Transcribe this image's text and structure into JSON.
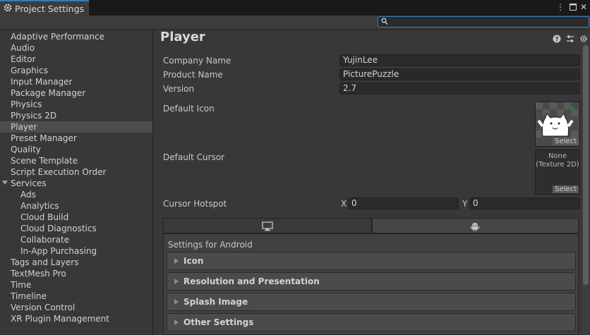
{
  "window": {
    "tab_title": "Project Settings"
  },
  "search": {
    "value": "",
    "placeholder": ""
  },
  "sidebar": {
    "items": [
      {
        "label": "Adaptive Performance"
      },
      {
        "label": "Audio"
      },
      {
        "label": "Editor"
      },
      {
        "label": "Graphics"
      },
      {
        "label": "Input Manager"
      },
      {
        "label": "Package Manager"
      },
      {
        "label": "Physics"
      },
      {
        "label": "Physics 2D"
      },
      {
        "label": "Player"
      },
      {
        "label": "Preset Manager"
      },
      {
        "label": "Quality"
      },
      {
        "label": "Scene Template"
      },
      {
        "label": "Script Execution Order"
      },
      {
        "label": "Services"
      },
      {
        "label": "Ads"
      },
      {
        "label": "Analytics"
      },
      {
        "label": "Cloud Build"
      },
      {
        "label": "Cloud Diagnostics"
      },
      {
        "label": "Collaborate"
      },
      {
        "label": "In-App Purchasing"
      },
      {
        "label": "Tags and Layers"
      },
      {
        "label": "TextMesh Pro"
      },
      {
        "label": "Time"
      },
      {
        "label": "Timeline"
      },
      {
        "label": "Version Control"
      },
      {
        "label": "XR Plugin Management"
      }
    ],
    "selected": "Player"
  },
  "main": {
    "title": "Player",
    "company": {
      "label": "Company Name",
      "value": "YujinLee"
    },
    "product": {
      "label": "Product Name",
      "value": "PicturePuzzle"
    },
    "version": {
      "label": "Version",
      "value": "2.7"
    },
    "default_icon": {
      "label": "Default Icon",
      "select_label": "Select"
    },
    "default_cursor": {
      "label": "Default Cursor",
      "value_line1": "None",
      "value_line2": "(Texture 2D)",
      "select_label": "Select"
    },
    "hotspot": {
      "label": "Cursor Hotspot",
      "x_label": "X",
      "x_value": "0",
      "y_label": "Y",
      "y_value": "0"
    },
    "platform": {
      "tabs": [
        "standalone-monitor-icon",
        "android-icon"
      ],
      "selected": "android",
      "settings_title": "Settings for Android",
      "sections": [
        {
          "label": "Icon"
        },
        {
          "label": "Resolution and Presentation"
        },
        {
          "label": "Splash Image"
        },
        {
          "label": "Other Settings"
        }
      ]
    }
  },
  "colors": {
    "accent": "#3a79bb",
    "background": "#383838",
    "field": "#2a2a2a"
  }
}
